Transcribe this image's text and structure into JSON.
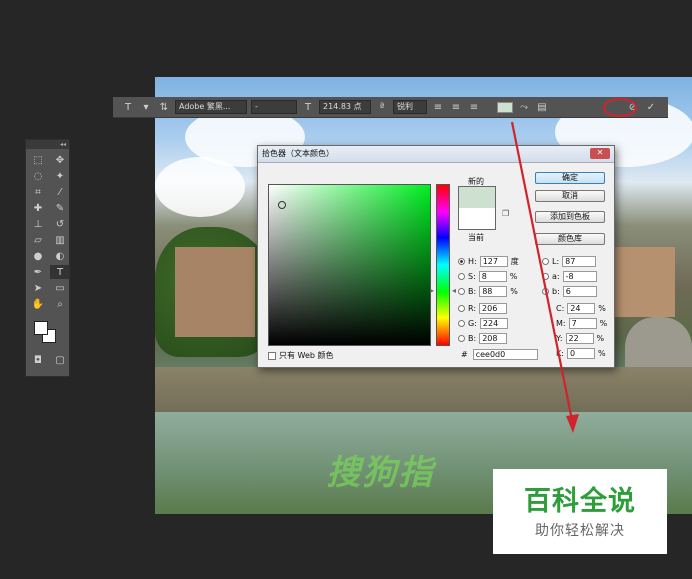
{
  "option_bar": {
    "font_family": "Adobe 繁黑...",
    "font_style": "-",
    "font_size": "214.83 点",
    "antialias": "锐利",
    "text_color_hex": "#cee0d0"
  },
  "dialog": {
    "title": "拾色器（文本颜色）",
    "close_label": "✕",
    "new_label": "新的",
    "current_label": "当前",
    "new_color": "#cee0d0",
    "current_color": "#ffffff",
    "buttons": {
      "ok": "确定",
      "cancel": "取消",
      "add_swatch": "添加到色板",
      "libraries": "颜色库"
    },
    "fields": {
      "H": {
        "label": "H:",
        "value": "127",
        "unit": "度"
      },
      "S": {
        "label": "S:",
        "value": "8",
        "unit": "%"
      },
      "B": {
        "label": "B:",
        "value": "88",
        "unit": "%"
      },
      "R": {
        "label": "R:",
        "value": "206"
      },
      "G": {
        "label": "G:",
        "value": "224"
      },
      "Bl": {
        "label": "B:",
        "value": "208"
      },
      "L": {
        "label": "L:",
        "value": "87"
      },
      "a": {
        "label": "a:",
        "value": "-8"
      },
      "b": {
        "label": "b:",
        "value": "6"
      },
      "C": {
        "label": "C:",
        "value": "24",
        "unit": "%"
      },
      "M": {
        "label": "M:",
        "value": "7",
        "unit": "%"
      },
      "Y": {
        "label": "Y:",
        "value": "22",
        "unit": "%"
      },
      "K": {
        "label": "K:",
        "value": "0",
        "unit": "%"
      }
    },
    "web_only_label": "只有 Web 颜色",
    "hex_label": "#",
    "hex_value": "cee0d0"
  },
  "canvas": {
    "watermark_text": "搜狗指"
  },
  "logo": {
    "main": "百科全说",
    "sub": "助你轻松解决"
  },
  "colors": {
    "annotation": "#d0242c",
    "logo_green": "#2e9e3a"
  }
}
